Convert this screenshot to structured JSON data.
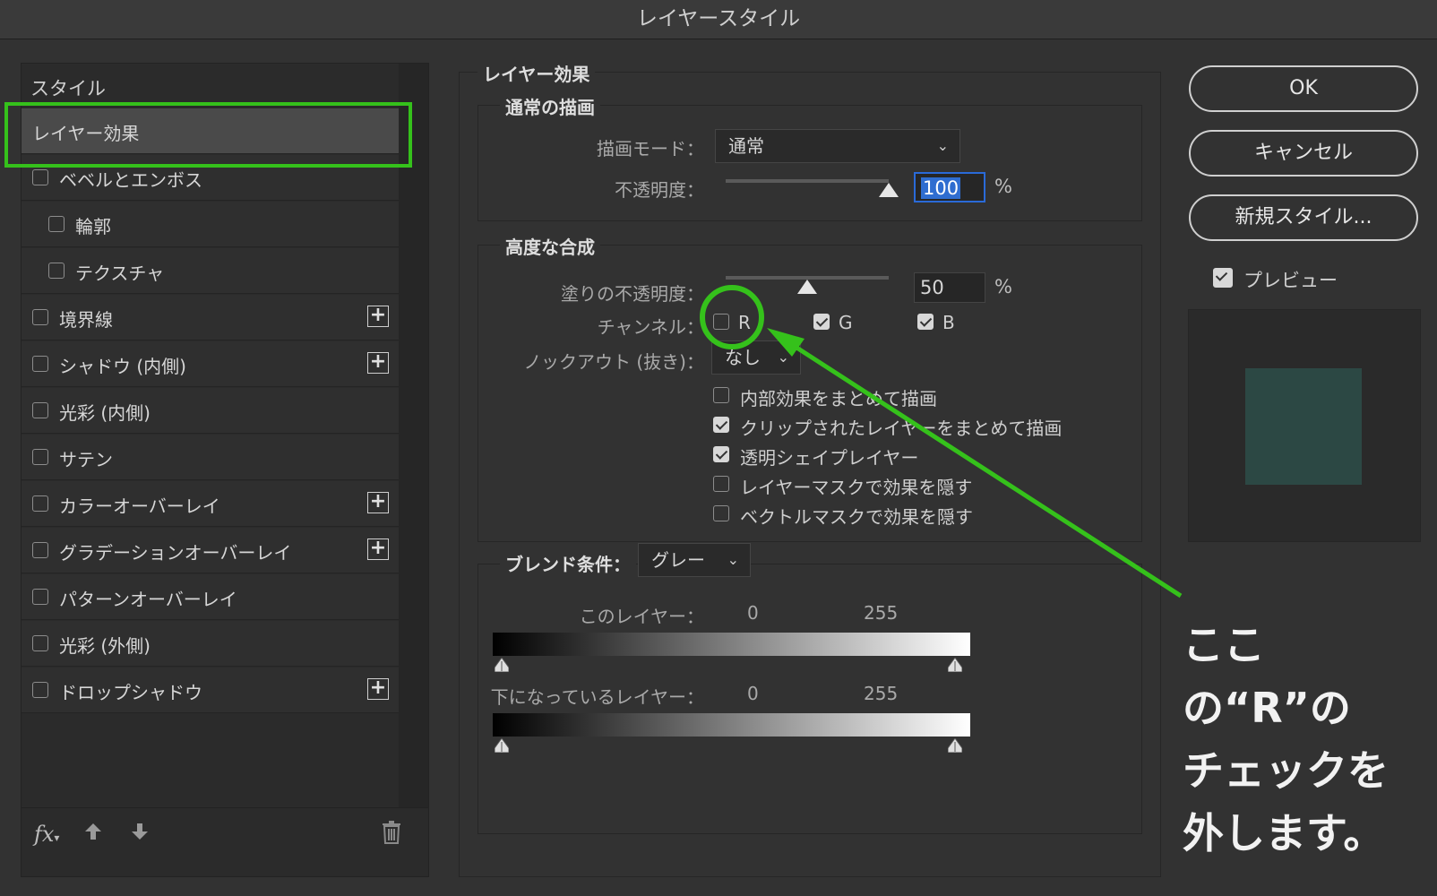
{
  "window": {
    "title": "レイヤースタイル"
  },
  "sidebar": {
    "header": "スタイル",
    "selected": "レイヤー効果",
    "items": [
      {
        "label": "ベベルとエンボス",
        "checked": false,
        "indent": false,
        "add": false
      },
      {
        "label": "輪郭",
        "checked": false,
        "indent": true,
        "add": false
      },
      {
        "label": "テクスチャ",
        "checked": false,
        "indent": true,
        "add": false
      },
      {
        "label": "境界線",
        "checked": false,
        "indent": false,
        "add": true
      },
      {
        "label": "シャドウ (内側)",
        "checked": false,
        "indent": false,
        "add": true
      },
      {
        "label": "光彩 (内側)",
        "checked": false,
        "indent": false,
        "add": false
      },
      {
        "label": "サテン",
        "checked": false,
        "indent": false,
        "add": false
      },
      {
        "label": "カラーオーバーレイ",
        "checked": false,
        "indent": false,
        "add": true
      },
      {
        "label": "グラデーションオーバーレイ",
        "checked": false,
        "indent": false,
        "add": true
      },
      {
        "label": "パターンオーバーレイ",
        "checked": false,
        "indent": false,
        "add": false
      },
      {
        "label": "光彩 (外側)",
        "checked": false,
        "indent": false,
        "add": false
      },
      {
        "label": "ドロップシャドウ",
        "checked": false,
        "indent": false,
        "add": true
      }
    ],
    "footer": {
      "fx": "fx"
    }
  },
  "effects": {
    "title": "レイヤー効果",
    "normal": {
      "title": "通常の描画",
      "blend_mode_label": "描画モード：",
      "blend_mode_value": "通常",
      "opacity_label": "不透明度：",
      "opacity_value": "100",
      "opacity_unit": "%",
      "opacity_fraction": 1.0
    },
    "advanced": {
      "title": "高度な合成",
      "fill_label": "塗りの不透明度：",
      "fill_value": "50",
      "fill_unit": "%",
      "fill_fraction": 0.5,
      "channel_label": "チャンネル：",
      "channels": [
        {
          "name": "R",
          "checked": false
        },
        {
          "name": "G",
          "checked": true
        },
        {
          "name": "B",
          "checked": true
        }
      ],
      "knockout_label": "ノックアウト (抜き)：",
      "knockout_value": "なし",
      "options": [
        {
          "label": "内部効果をまとめて描画",
          "checked": false
        },
        {
          "label": "クリップされたレイヤーをまとめて描画",
          "checked": true
        },
        {
          "label": "透明シェイプレイヤー",
          "checked": true
        },
        {
          "label": "レイヤーマスクで効果を隠す",
          "checked": false
        },
        {
          "label": "ベクトルマスクで効果を隠す",
          "checked": false
        }
      ]
    },
    "blend_if": {
      "label": "ブレンド条件：",
      "value": "グレー",
      "this_layer_label": "このレイヤー：",
      "this_layer_low": "0",
      "this_layer_high": "255",
      "underlying_label": "下になっているレイヤー：",
      "underlying_low": "0",
      "underlying_high": "255"
    }
  },
  "buttons": {
    "ok": "OK",
    "cancel": "キャンセル",
    "new_style": "新規スタイル...",
    "preview_label": "プレビュー",
    "preview_checked": true
  },
  "preview": {
    "swatch_color": "#2c4844"
  },
  "annotation": {
    "lines": [
      "ここの“R”の",
      "チェックを",
      "外します。"
    ],
    "color": "#35c11b"
  }
}
